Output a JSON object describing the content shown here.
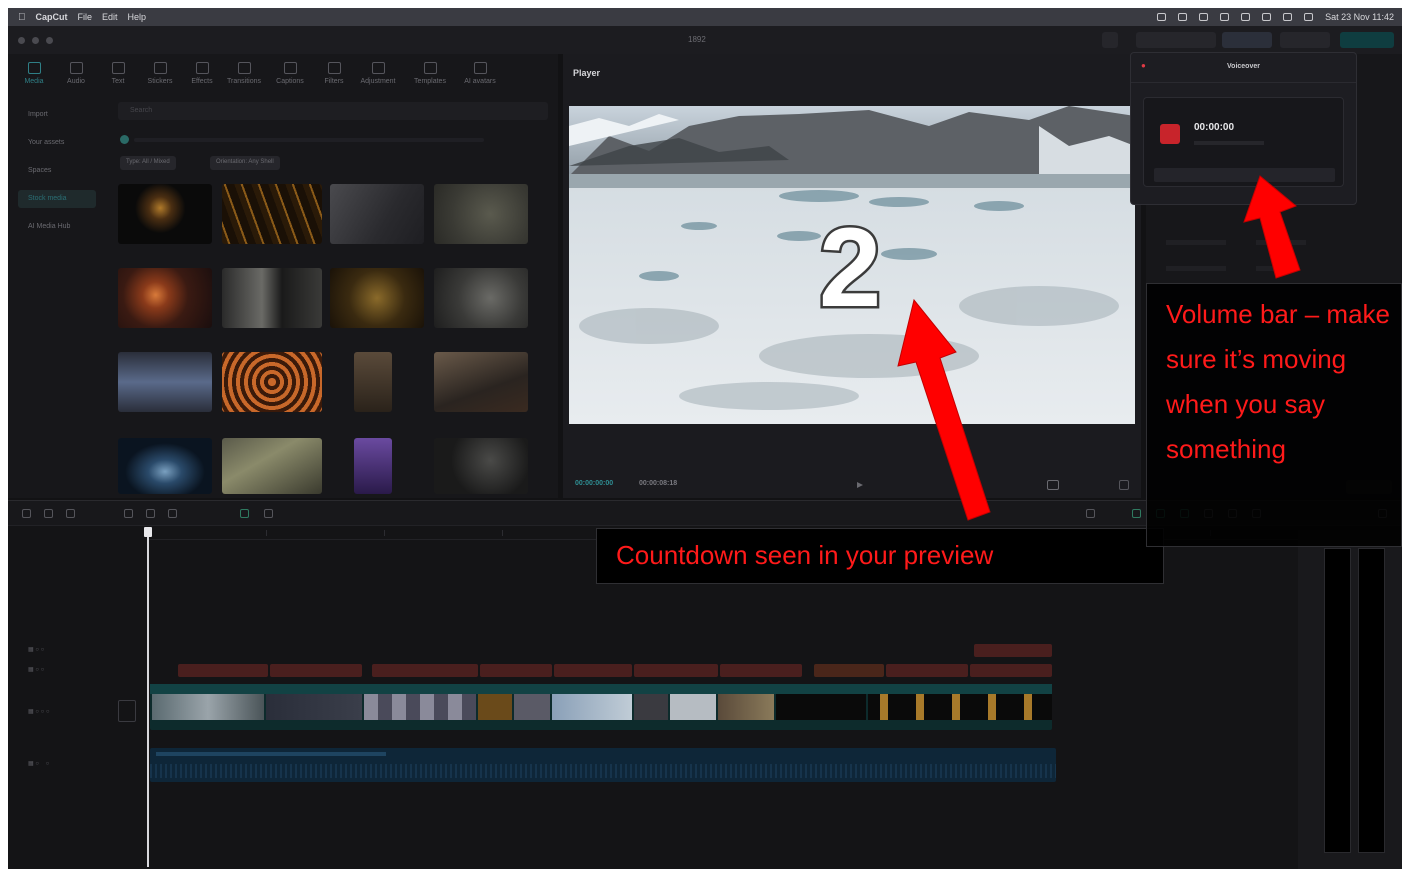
{
  "menubar": {
    "app": "CapCut",
    "menus": [
      "File",
      "Edit",
      "Help"
    ],
    "clock": "Sat 23 Nov  11:42"
  },
  "app": {
    "title": "1892"
  },
  "media": {
    "tools": [
      "Media",
      "Audio",
      "Text",
      "Stickers",
      "Effects",
      "Transitions",
      "Captions",
      "Filters",
      "Adjustment",
      "Templates",
      "AI avatars"
    ],
    "sidebar": [
      "Import",
      "Your assets",
      "Spaces",
      "Stock media",
      "AI Media Hub"
    ],
    "search_placeholder": "Search",
    "filters": [
      "Type: All / Mixed",
      "Orientation: Any Shell"
    ]
  },
  "player": {
    "label": "Player",
    "countdown": "2",
    "time_current": "00:00:00:00",
    "time_total": "00:00:08:18"
  },
  "voiceover": {
    "title": "Voiceover",
    "time": "00:00:00",
    "level": 0.0
  },
  "annotations": {
    "countdown_note": "Countdown seen in your preview",
    "volume_note": "Volume bar – make sure it’s moving when you say something"
  },
  "colors": {
    "annotation_red": "#ff1a1a",
    "record_red": "#c8242b",
    "app_bg": "#121214"
  }
}
